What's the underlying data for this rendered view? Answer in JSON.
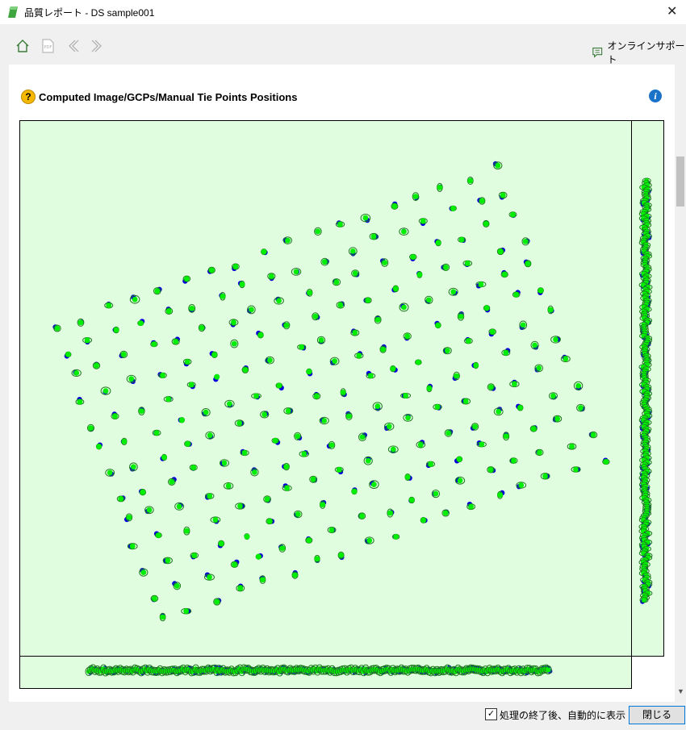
{
  "window": {
    "title": "品質レポート - DS sample001",
    "close_glyph": "✕"
  },
  "toolbar": {
    "home_icon": "home-icon",
    "pdf_icon": "pdf-icon",
    "back_icon": "chevron-left-icon",
    "forward_icon": "chevron-right-icon",
    "support_label": "オンラインサポート"
  },
  "section": {
    "title": "Computed Image/GCPs/Manual Tie Points Positions",
    "help_glyph": "?",
    "info_glyph": "i"
  },
  "footer": {
    "checkbox_label": "処理の終了後、自動的に表示",
    "checkbox_checked": true,
    "close_label": "閉じる"
  },
  "colors": {
    "plot_bg": "#e0fde0",
    "computed": "#00ee00",
    "initial": "#0000dd",
    "ellipse": "#1e7a1e",
    "accent": "#0078d7"
  },
  "chart_data": {
    "type": "scatter",
    "series": [
      {
        "name": "",
        "color": "#0000dd"
      },
      {
        "name": "",
        "color": "#00ee00"
      }
    ],
    "grid": {
      "rows": 13,
      "cols": 18
    },
    "grid_rotation_deg": -20,
    "ellipses": true,
    "side_projection": "right",
    "bottom_projection": "bottom"
  }
}
